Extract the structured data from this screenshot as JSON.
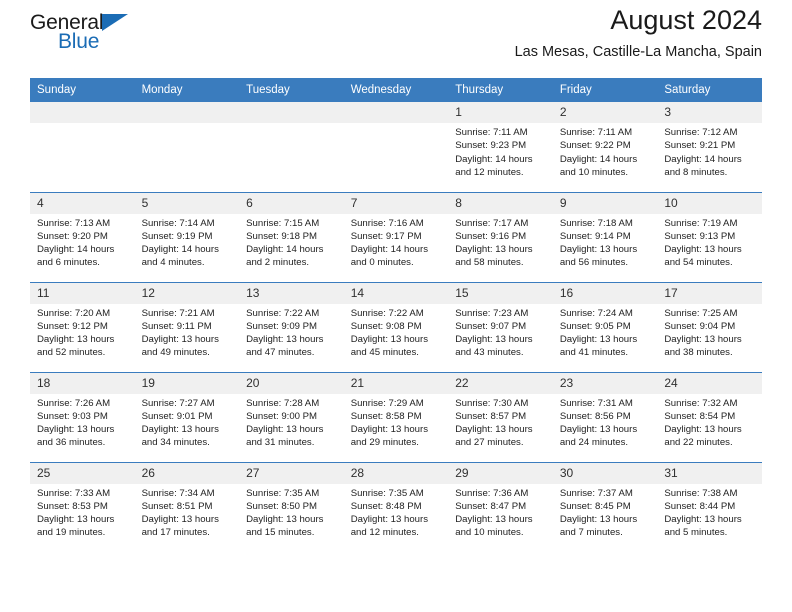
{
  "brand": {
    "name_part1": "General",
    "name_part2": "Blue",
    "logo_icon": "triangle-icon",
    "accent_color": "#1b6cb5"
  },
  "header": {
    "title": "August 2024",
    "subtitle": "Las Mesas, Castille-La Mancha, Spain"
  },
  "calendar": {
    "header_bg": "#3a7cbe",
    "daynum_bg": "#f0f0f0",
    "weekday_headers": [
      "Sunday",
      "Monday",
      "Tuesday",
      "Wednesday",
      "Thursday",
      "Friday",
      "Saturday"
    ],
    "weeks": [
      [
        {
          "day": "",
          "empty": true,
          "lines": []
        },
        {
          "day": "",
          "empty": true,
          "lines": []
        },
        {
          "day": "",
          "empty": true,
          "lines": []
        },
        {
          "day": "",
          "empty": true,
          "lines": []
        },
        {
          "day": "1",
          "empty": false,
          "lines": [
            "Sunrise: 7:11 AM",
            "Sunset: 9:23 PM",
            "Daylight: 14 hours",
            "and 12 minutes."
          ]
        },
        {
          "day": "2",
          "empty": false,
          "lines": [
            "Sunrise: 7:11 AM",
            "Sunset: 9:22 PM",
            "Daylight: 14 hours",
            "and 10 minutes."
          ]
        },
        {
          "day": "3",
          "empty": false,
          "lines": [
            "Sunrise: 7:12 AM",
            "Sunset: 9:21 PM",
            "Daylight: 14 hours",
            "and 8 minutes."
          ]
        }
      ],
      [
        {
          "day": "4",
          "empty": false,
          "lines": [
            "Sunrise: 7:13 AM",
            "Sunset: 9:20 PM",
            "Daylight: 14 hours",
            "and 6 minutes."
          ]
        },
        {
          "day": "5",
          "empty": false,
          "lines": [
            "Sunrise: 7:14 AM",
            "Sunset: 9:19 PM",
            "Daylight: 14 hours",
            "and 4 minutes."
          ]
        },
        {
          "day": "6",
          "empty": false,
          "lines": [
            "Sunrise: 7:15 AM",
            "Sunset: 9:18 PM",
            "Daylight: 14 hours",
            "and 2 minutes."
          ]
        },
        {
          "day": "7",
          "empty": false,
          "lines": [
            "Sunrise: 7:16 AM",
            "Sunset: 9:17 PM",
            "Daylight: 14 hours",
            "and 0 minutes."
          ]
        },
        {
          "day": "8",
          "empty": false,
          "lines": [
            "Sunrise: 7:17 AM",
            "Sunset: 9:16 PM",
            "Daylight: 13 hours",
            "and 58 minutes."
          ]
        },
        {
          "day": "9",
          "empty": false,
          "lines": [
            "Sunrise: 7:18 AM",
            "Sunset: 9:14 PM",
            "Daylight: 13 hours",
            "and 56 minutes."
          ]
        },
        {
          "day": "10",
          "empty": false,
          "lines": [
            "Sunrise: 7:19 AM",
            "Sunset: 9:13 PM",
            "Daylight: 13 hours",
            "and 54 minutes."
          ]
        }
      ],
      [
        {
          "day": "11",
          "empty": false,
          "lines": [
            "Sunrise: 7:20 AM",
            "Sunset: 9:12 PM",
            "Daylight: 13 hours",
            "and 52 minutes."
          ]
        },
        {
          "day": "12",
          "empty": false,
          "lines": [
            "Sunrise: 7:21 AM",
            "Sunset: 9:11 PM",
            "Daylight: 13 hours",
            "and 49 minutes."
          ]
        },
        {
          "day": "13",
          "empty": false,
          "lines": [
            "Sunrise: 7:22 AM",
            "Sunset: 9:09 PM",
            "Daylight: 13 hours",
            "and 47 minutes."
          ]
        },
        {
          "day": "14",
          "empty": false,
          "lines": [
            "Sunrise: 7:22 AM",
            "Sunset: 9:08 PM",
            "Daylight: 13 hours",
            "and 45 minutes."
          ]
        },
        {
          "day": "15",
          "empty": false,
          "lines": [
            "Sunrise: 7:23 AM",
            "Sunset: 9:07 PM",
            "Daylight: 13 hours",
            "and 43 minutes."
          ]
        },
        {
          "day": "16",
          "empty": false,
          "lines": [
            "Sunrise: 7:24 AM",
            "Sunset: 9:05 PM",
            "Daylight: 13 hours",
            "and 41 minutes."
          ]
        },
        {
          "day": "17",
          "empty": false,
          "lines": [
            "Sunrise: 7:25 AM",
            "Sunset: 9:04 PM",
            "Daylight: 13 hours",
            "and 38 minutes."
          ]
        }
      ],
      [
        {
          "day": "18",
          "empty": false,
          "lines": [
            "Sunrise: 7:26 AM",
            "Sunset: 9:03 PM",
            "Daylight: 13 hours",
            "and 36 minutes."
          ]
        },
        {
          "day": "19",
          "empty": false,
          "lines": [
            "Sunrise: 7:27 AM",
            "Sunset: 9:01 PM",
            "Daylight: 13 hours",
            "and 34 minutes."
          ]
        },
        {
          "day": "20",
          "empty": false,
          "lines": [
            "Sunrise: 7:28 AM",
            "Sunset: 9:00 PM",
            "Daylight: 13 hours",
            "and 31 minutes."
          ]
        },
        {
          "day": "21",
          "empty": false,
          "lines": [
            "Sunrise: 7:29 AM",
            "Sunset: 8:58 PM",
            "Daylight: 13 hours",
            "and 29 minutes."
          ]
        },
        {
          "day": "22",
          "empty": false,
          "lines": [
            "Sunrise: 7:30 AM",
            "Sunset: 8:57 PM",
            "Daylight: 13 hours",
            "and 27 minutes."
          ]
        },
        {
          "day": "23",
          "empty": false,
          "lines": [
            "Sunrise: 7:31 AM",
            "Sunset: 8:56 PM",
            "Daylight: 13 hours",
            "and 24 minutes."
          ]
        },
        {
          "day": "24",
          "empty": false,
          "lines": [
            "Sunrise: 7:32 AM",
            "Sunset: 8:54 PM",
            "Daylight: 13 hours",
            "and 22 minutes."
          ]
        }
      ],
      [
        {
          "day": "25",
          "empty": false,
          "lines": [
            "Sunrise: 7:33 AM",
            "Sunset: 8:53 PM",
            "Daylight: 13 hours",
            "and 19 minutes."
          ]
        },
        {
          "day": "26",
          "empty": false,
          "lines": [
            "Sunrise: 7:34 AM",
            "Sunset: 8:51 PM",
            "Daylight: 13 hours",
            "and 17 minutes."
          ]
        },
        {
          "day": "27",
          "empty": false,
          "lines": [
            "Sunrise: 7:35 AM",
            "Sunset: 8:50 PM",
            "Daylight: 13 hours",
            "and 15 minutes."
          ]
        },
        {
          "day": "28",
          "empty": false,
          "lines": [
            "Sunrise: 7:35 AM",
            "Sunset: 8:48 PM",
            "Daylight: 13 hours",
            "and 12 minutes."
          ]
        },
        {
          "day": "29",
          "empty": false,
          "lines": [
            "Sunrise: 7:36 AM",
            "Sunset: 8:47 PM",
            "Daylight: 13 hours",
            "and 10 minutes."
          ]
        },
        {
          "day": "30",
          "empty": false,
          "lines": [
            "Sunrise: 7:37 AM",
            "Sunset: 8:45 PM",
            "Daylight: 13 hours",
            "and 7 minutes."
          ]
        },
        {
          "day": "31",
          "empty": false,
          "lines": [
            "Sunrise: 7:38 AM",
            "Sunset: 8:44 PM",
            "Daylight: 13 hours",
            "and 5 minutes."
          ]
        }
      ]
    ]
  }
}
